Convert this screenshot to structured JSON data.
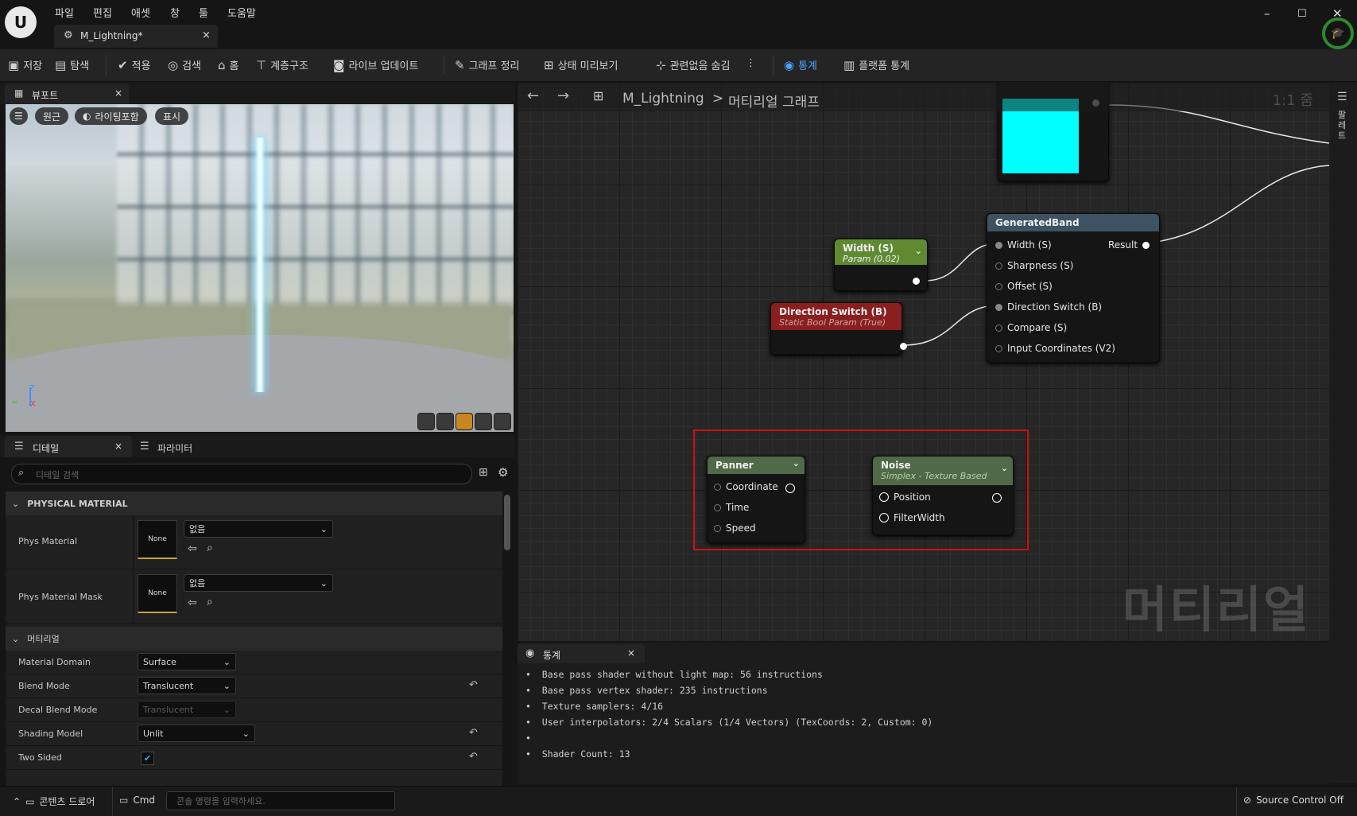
{
  "menu": [
    "파일",
    "편집",
    "애셋",
    "창",
    "툴",
    "도움말"
  ],
  "document_tab": {
    "label": "M_Lightning*",
    "close": "×"
  },
  "window_controls": {
    "minimize": "–",
    "maximize": "☐",
    "close": "✕"
  },
  "toolbar": {
    "save": "저장",
    "browse": "탐색",
    "apply": "적용",
    "search": "검색",
    "home": "홈",
    "hierarchy": "계층구조",
    "live_update": "라이브 업데이트",
    "clean_graph": "그래프 정리",
    "preview_state": "상태 미리보기",
    "hide_unrelated": "관련없음 숨김",
    "stats": "통계",
    "platform_stats": "플랫폼 통계"
  },
  "viewport": {
    "tab_label": "뷰포트",
    "tab_close": "×",
    "perspective": "원근",
    "lighting": "라이팅포함",
    "show": "표시",
    "axis": {
      "z": "Z",
      "x": "X"
    }
  },
  "details": {
    "tab_label": "디테일",
    "tab_close": "×",
    "params_tab_label": "파라미터",
    "search_placeholder": "디테일 검색",
    "section_physical": "PHYSICAL MATERIAL",
    "phys_material_label": "Phys Material",
    "phys_material_thumb": "None",
    "phys_material_value": "없음",
    "phys_mask_label": "Phys Material Mask",
    "phys_mask_thumb": "None",
    "phys_mask_value": "없음",
    "section_material": "머티리얼",
    "material_domain_label": "Material Domain",
    "material_domain_value": "Surface",
    "blend_mode_label": "Blend Mode",
    "blend_mode_value": "Translucent",
    "decal_blend_label": "Decal Blend Mode",
    "decal_blend_value": "Translucent",
    "shading_model_label": "Shading Model",
    "shading_model_value": "Unlit",
    "two_sided_label": "Two Sided",
    "two_sided_checked": true
  },
  "graph": {
    "breadcrumb_asset": "M_Lightning",
    "breadcrumb_sep": ">",
    "breadcrumb_graph": "머티리얼 그래프",
    "zoom": "1:1 줌",
    "watermark": "머티리얼",
    "side_tab": "팔레트",
    "nodes": {
      "width_param": {
        "title": "Width (S)",
        "subtitle": "Param (0.02)",
        "color": "#5f8a32"
      },
      "direction_switch": {
        "title": "Direction Switch (B)",
        "subtitle": "Static Bool Param (True)",
        "color": "#8a1f1f"
      },
      "generated_band": {
        "title": "GeneratedBand",
        "color": "#3d5363",
        "inputs": [
          "Width (S)",
          "Sharpness (S)",
          "Offset (S)",
          "Direction Switch (B)",
          "Compare (S)",
          "Input Coordinates (V2)"
        ],
        "output": "Result"
      },
      "panner": {
        "title": "Panner",
        "color": "#506a48",
        "inputs": [
          "Coordinate",
          "Time",
          "Speed"
        ]
      },
      "noise": {
        "title": "Noise",
        "subtitle": "Simplex - Texture Based",
        "color": "#506a48",
        "inputs": [
          "Position",
          "FilterWidth"
        ]
      },
      "constant_color": {
        "color": "#00ffff"
      }
    }
  },
  "stats": {
    "tab_label": "통계",
    "tab_close": "×",
    "lines": [
      "Base pass shader without light map: 56 instructions",
      "Base pass vertex shader: 235 instructions",
      "Texture samplers: 4/16",
      "User interpolators: 2/4 Scalars (1/4 Vectors) (TexCoords: 2, Custom: 0)",
      "",
      "Shader Count: 13"
    ]
  },
  "statusbar": {
    "content_drawer": "콘텐츠 드로어",
    "cmd": "Cmd",
    "cmd_placeholder": "콘솔 명령을 입력하세요.",
    "source_control": "Source Control Off"
  }
}
